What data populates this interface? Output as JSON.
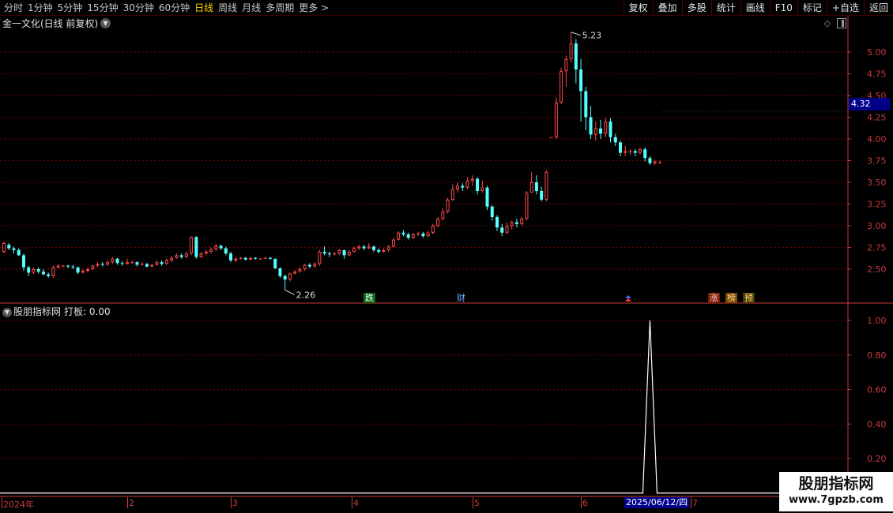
{
  "toolbar": {
    "periods": [
      "分时",
      "1分钟",
      "5分钟",
      "15分钟",
      "30分钟",
      "60分钟",
      "日线",
      "周线",
      "月线",
      "多周期",
      "更多 >"
    ],
    "active_period": "日线",
    "actions": [
      "复权",
      "叠加",
      "多股",
      "统计",
      "画线",
      "F10",
      "标记",
      "+自选",
      "返回"
    ]
  },
  "main_chart": {
    "title": "金一文化(日线 前复权)",
    "price_ticks": [
      "5.00",
      "4.75",
      "4.50",
      "4.25",
      "4.00",
      "3.75",
      "3.50",
      "3.25",
      "3.00",
      "2.75",
      "2.50"
    ],
    "current_price": "4.32",
    "high_label": "5.23",
    "low_label": "2.26",
    "badges": {
      "fall": "跌",
      "finance": "财",
      "rise": "涨",
      "rank": "榜",
      "forecast": "预"
    }
  },
  "sub_chart": {
    "name": "股朋指标网",
    "value_label": "打板: 0.00",
    "ticks": [
      "1.00",
      "0.80",
      "0.60",
      "0.40",
      "0.20"
    ]
  },
  "date_axis": {
    "labels": [
      "2024年",
      "2",
      "3",
      "4",
      "5",
      "6",
      "7"
    ],
    "cursor_date": "2025/06/12/四"
  },
  "watermark": {
    "title": "股朋指标网",
    "url": "www.7gpzb.com"
  },
  "colors": {
    "up": "#ff4a4a",
    "down": "#54ffff",
    "grid": "#7a0000",
    "axis": "#c83c3c",
    "active": "#ffd700"
  },
  "chart_data": [
    {
      "type": "candlestick",
      "ylim": [
        2.3,
        5.35
      ],
      "candles": [
        [
          2.7,
          2.8,
          2.82,
          2.68
        ],
        [
          2.78,
          2.74,
          2.8,
          2.72
        ],
        [
          2.74,
          2.72,
          2.76,
          2.68
        ],
        [
          2.72,
          2.66,
          2.74,
          2.65
        ],
        [
          2.66,
          2.52,
          2.68,
          2.48
        ],
        [
          2.52,
          2.46,
          2.54,
          2.42
        ],
        [
          2.46,
          2.5,
          2.52,
          2.44
        ],
        [
          2.5,
          2.47,
          2.52,
          2.45
        ],
        [
          2.47,
          2.44,
          2.5,
          2.43
        ],
        [
          2.44,
          2.42,
          2.46,
          2.4
        ],
        [
          2.42,
          2.52,
          2.54,
          2.4
        ],
        [
          2.52,
          2.54,
          2.56,
          2.51
        ],
        [
          2.54,
          2.54,
          2.55,
          2.52
        ],
        [
          2.54,
          2.53,
          2.55,
          2.51
        ],
        [
          2.53,
          2.52,
          2.55,
          2.5
        ],
        [
          2.52,
          2.46,
          2.53,
          2.44
        ],
        [
          2.46,
          2.48,
          2.5,
          2.45
        ],
        [
          2.48,
          2.5,
          2.52,
          2.46
        ],
        [
          2.5,
          2.54,
          2.55,
          2.49
        ],
        [
          2.54,
          2.56,
          2.58,
          2.52
        ],
        [
          2.56,
          2.55,
          2.58,
          2.53
        ],
        [
          2.55,
          2.58,
          2.6,
          2.54
        ],
        [
          2.58,
          2.62,
          2.64,
          2.56
        ],
        [
          2.62,
          2.57,
          2.63,
          2.55
        ],
        [
          2.57,
          2.56,
          2.59,
          2.54
        ],
        [
          2.56,
          2.58,
          2.62,
          2.55
        ],
        [
          2.58,
          2.58,
          2.6,
          2.56
        ],
        [
          2.58,
          2.55,
          2.59,
          2.53
        ],
        [
          2.55,
          2.56,
          2.58,
          2.54
        ],
        [
          2.56,
          2.53,
          2.57,
          2.52
        ],
        [
          2.53,
          2.55,
          2.56,
          2.52
        ],
        [
          2.55,
          2.58,
          2.6,
          2.54
        ],
        [
          2.58,
          2.56,
          2.6,
          2.54
        ],
        [
          2.56,
          2.6,
          2.62,
          2.55
        ],
        [
          2.6,
          2.63,
          2.65,
          2.58
        ],
        [
          2.63,
          2.66,
          2.68,
          2.62
        ],
        [
          2.66,
          2.64,
          2.68,
          2.62
        ],
        [
          2.64,
          2.68,
          2.7,
          2.63
        ],
        [
          2.68,
          2.87,
          2.88,
          2.66
        ],
        [
          2.87,
          2.64,
          2.88,
          2.62
        ],
        [
          2.64,
          2.68,
          2.7,
          2.63
        ],
        [
          2.68,
          2.7,
          2.72,
          2.66
        ],
        [
          2.7,
          2.73,
          2.75,
          2.68
        ],
        [
          2.73,
          2.77,
          2.79,
          2.71
        ],
        [
          2.77,
          2.74,
          2.78,
          2.72
        ],
        [
          2.74,
          2.68,
          2.76,
          2.66
        ],
        [
          2.68,
          2.6,
          2.7,
          2.58
        ],
        [
          2.6,
          2.62,
          2.64,
          2.58
        ],
        [
          2.62,
          2.63,
          2.64,
          2.61
        ],
        [
          2.63,
          2.61,
          2.64,
          2.6
        ],
        [
          2.61,
          2.63,
          2.64,
          2.6
        ],
        [
          2.63,
          2.62,
          2.64,
          2.61
        ],
        [
          2.62,
          2.62,
          2.63,
          2.61
        ],
        [
          2.62,
          2.63,
          2.64,
          2.62
        ],
        [
          2.63,
          2.62,
          2.64,
          2.61
        ],
        [
          2.62,
          2.51,
          2.62,
          2.5
        ],
        [
          2.51,
          2.42,
          2.52,
          2.4
        ],
        [
          2.42,
          2.38,
          2.44,
          2.26
        ],
        [
          2.38,
          2.45,
          2.46,
          2.36
        ],
        [
          2.45,
          2.47,
          2.49,
          2.44
        ],
        [
          2.47,
          2.5,
          2.52,
          2.46
        ],
        [
          2.5,
          2.55,
          2.56,
          2.48
        ],
        [
          2.55,
          2.53,
          2.57,
          2.51
        ],
        [
          2.53,
          2.56,
          2.58,
          2.52
        ],
        [
          2.56,
          2.7,
          2.72,
          2.54
        ],
        [
          2.7,
          2.68,
          2.76,
          2.66
        ],
        [
          2.68,
          2.67,
          2.7,
          2.64
        ],
        [
          2.67,
          2.68,
          2.7,
          2.66
        ],
        [
          2.68,
          2.72,
          2.73,
          2.66
        ],
        [
          2.72,
          2.66,
          2.72,
          2.62
        ],
        [
          2.66,
          2.7,
          2.72,
          2.65
        ],
        [
          2.7,
          2.74,
          2.76,
          2.69
        ],
        [
          2.74,
          2.76,
          2.78,
          2.72
        ],
        [
          2.76,
          2.74,
          2.78,
          2.72
        ],
        [
          2.74,
          2.76,
          2.8,
          2.73
        ],
        [
          2.76,
          2.72,
          2.77,
          2.7
        ],
        [
          2.72,
          2.7,
          2.74,
          2.68
        ],
        [
          2.7,
          2.72,
          2.74,
          2.69
        ],
        [
          2.72,
          2.76,
          2.78,
          2.7
        ],
        [
          2.76,
          2.84,
          2.86,
          2.75
        ],
        [
          2.84,
          2.92,
          2.94,
          2.83
        ],
        [
          2.92,
          2.9,
          2.95,
          2.88
        ],
        [
          2.9,
          2.86,
          2.92,
          2.84
        ],
        [
          2.86,
          2.9,
          2.92,
          2.85
        ],
        [
          2.9,
          2.91,
          2.93,
          2.88
        ],
        [
          2.91,
          2.88,
          2.93,
          2.86
        ],
        [
          2.88,
          2.92,
          2.94,
          2.87
        ],
        [
          2.92,
          3.0,
          3.02,
          2.9
        ],
        [
          3.0,
          3.08,
          3.1,
          2.98
        ],
        [
          3.08,
          3.16,
          3.2,
          3.06
        ],
        [
          3.16,
          3.3,
          3.32,
          3.14
        ],
        [
          3.3,
          3.42,
          3.48,
          3.28
        ],
        [
          3.42,
          3.46,
          3.5,
          3.38
        ],
        [
          3.46,
          3.44,
          3.49,
          3.4
        ],
        [
          3.44,
          3.52,
          3.56,
          3.42
        ],
        [
          3.52,
          3.54,
          3.58,
          3.46
        ],
        [
          3.54,
          3.4,
          3.56,
          3.36
        ],
        [
          3.4,
          3.44,
          3.52,
          3.38
        ],
        [
          3.44,
          3.22,
          3.46,
          3.18
        ],
        [
          3.22,
          3.1,
          3.24,
          3.06
        ],
        [
          3.1,
          2.98,
          3.12,
          2.94
        ],
        [
          2.98,
          2.92,
          3.02,
          2.88
        ],
        [
          2.92,
          3.0,
          3.04,
          2.9
        ],
        [
          3.0,
          3.04,
          3.06,
          2.96
        ],
        [
          3.04,
          3.02,
          3.08,
          2.98
        ],
        [
          3.02,
          3.08,
          3.1,
          3.0
        ],
        [
          3.08,
          3.38,
          3.4,
          3.06
        ],
        [
          3.38,
          3.5,
          3.62,
          3.4
        ],
        [
          3.5,
          3.4,
          3.58,
          3.36
        ],
        [
          3.4,
          3.3,
          3.45,
          3.28
        ],
        [
          3.3,
          3.62,
          3.64,
          3.28
        ],
        [
          4.02,
          4.02,
          4.02,
          4.02
        ],
        [
          4.02,
          4.42,
          4.48,
          4.0
        ],
        [
          4.42,
          4.78,
          4.82,
          4.4
        ],
        [
          4.78,
          4.92,
          4.96,
          4.6
        ],
        [
          4.92,
          5.1,
          5.23,
          4.88
        ],
        [
          5.1,
          4.8,
          5.15,
          4.64
        ],
        [
          4.8,
          4.55,
          4.92,
          4.2
        ],
        [
          4.55,
          4.25,
          4.6,
          4.1
        ],
        [
          4.25,
          4.05,
          4.38,
          4.0
        ],
        [
          4.05,
          4.12,
          4.2,
          3.98
        ],
        [
          4.12,
          4.06,
          4.22,
          4.0
        ],
        [
          4.06,
          4.2,
          4.24,
          4.02
        ],
        [
          4.2,
          4.02,
          4.24,
          3.96
        ],
        [
          4.02,
          3.96,
          4.06,
          3.92
        ],
        [
          3.96,
          3.84,
          3.98,
          3.8
        ],
        [
          3.84,
          3.86,
          3.92,
          3.8
        ],
        [
          3.86,
          3.86,
          3.88,
          3.82
        ],
        [
          3.86,
          3.84,
          3.88,
          3.8
        ],
        [
          3.84,
          3.88,
          3.9,
          3.82
        ],
        [
          3.88,
          3.78,
          3.9,
          3.74
        ],
        [
          3.78,
          3.72,
          3.8,
          3.7
        ],
        [
          3.72,
          3.74,
          3.76,
          3.7
        ],
        [
          3.73,
          3.73,
          3.75,
          3.71
        ]
      ]
    },
    {
      "type": "line",
      "name": "打板",
      "ylim": [
        0,
        1
      ],
      "spike_index": 131,
      "spike_value": 1.0,
      "baseline": 0.0
    }
  ]
}
